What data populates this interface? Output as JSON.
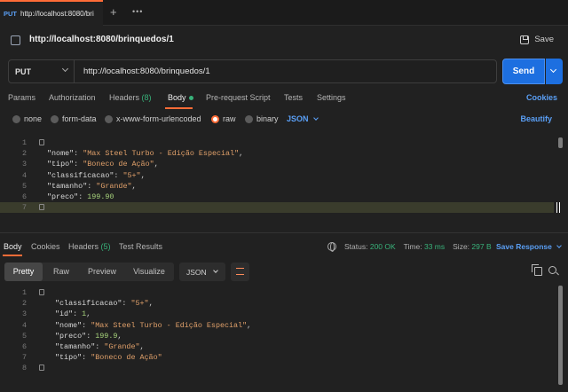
{
  "tab": {
    "method": "PUT",
    "url": "http://localhost:8080/bri",
    "more": "•••",
    "plus": "+"
  },
  "request": {
    "title": "http://localhost:8080/brinquedos/1",
    "save_label": "Save",
    "method": "PUT",
    "url": "http://localhost:8080/brinquedos/1",
    "send_label": "Send"
  },
  "request_tabs": {
    "params": "Params",
    "authorization": "Authorization",
    "headers": "Headers",
    "headers_count": "(8)",
    "body": "Body",
    "pre_request": "Pre-request Script",
    "tests": "Tests",
    "settings": "Settings",
    "cookies": "Cookies"
  },
  "body_options": {
    "none": "none",
    "form_data": "form-data",
    "urlencoded": "x-www-form-urlencoded",
    "raw": "raw",
    "binary": "binary",
    "format": "JSON",
    "beautify": "Beautify"
  },
  "request_body": [
    {
      "n": "1",
      "text": "{"
    },
    {
      "n": "2",
      "key": "\"nome\"",
      "value": "\"Max Steel Turbo - Edição Especial\"",
      "type": "str",
      "comma": ","
    },
    {
      "n": "3",
      "key": "\"tipo\"",
      "value": "\"Boneco de Ação\"",
      "type": "str",
      "comma": ","
    },
    {
      "n": "4",
      "key": "\"classificacao\"",
      "value": "\"5+\"",
      "type": "str",
      "comma": ","
    },
    {
      "n": "5",
      "key": "\"tamanho\"",
      "value": "\"Grande\"",
      "type": "str",
      "comma": ","
    },
    {
      "n": "6",
      "key": "\"preco\"",
      "value": "199.90",
      "type": "num",
      "comma": ""
    },
    {
      "n": "7",
      "text": "}"
    }
  ],
  "response_tabs": {
    "body": "Body",
    "cookies": "Cookies",
    "headers": "Headers",
    "headers_count": "(5)",
    "test_results": "Test Results"
  },
  "response_status": {
    "status_label": "Status:",
    "status": "200 OK",
    "time_label": "Time:",
    "time": "33 ms",
    "size_label": "Size:",
    "size": "297 B",
    "save_response": "Save Response"
  },
  "response_view": {
    "pretty": "Pretty",
    "raw": "Raw",
    "preview": "Preview",
    "visualize": "Visualize",
    "format": "JSON"
  },
  "response_body": [
    {
      "n": "1",
      "text": "{"
    },
    {
      "n": "2",
      "key": "\"classificacao\"",
      "value": "\"5+\"",
      "type": "str",
      "comma": ","
    },
    {
      "n": "3",
      "key": "\"id\"",
      "value": "1",
      "type": "num",
      "comma": ","
    },
    {
      "n": "4",
      "key": "\"nome\"",
      "value": "\"Max Steel Turbo - Edição Especial\"",
      "type": "str",
      "comma": ","
    },
    {
      "n": "5",
      "key": "\"preco\"",
      "value": "199.9",
      "type": "num",
      "comma": ","
    },
    {
      "n": "6",
      "key": "\"tamanho\"",
      "value": "\"Grande\"",
      "type": "str",
      "comma": ","
    },
    {
      "n": "7",
      "key": "\"tipo\"",
      "value": "\"Boneco de Ação\"",
      "type": "str",
      "comma": ""
    },
    {
      "n": "8",
      "text": "}"
    }
  ],
  "colors": {
    "accent": "#ff6c37",
    "link": "#5a9ff5",
    "success": "#38b27a",
    "send": "#1d6fe0"
  }
}
